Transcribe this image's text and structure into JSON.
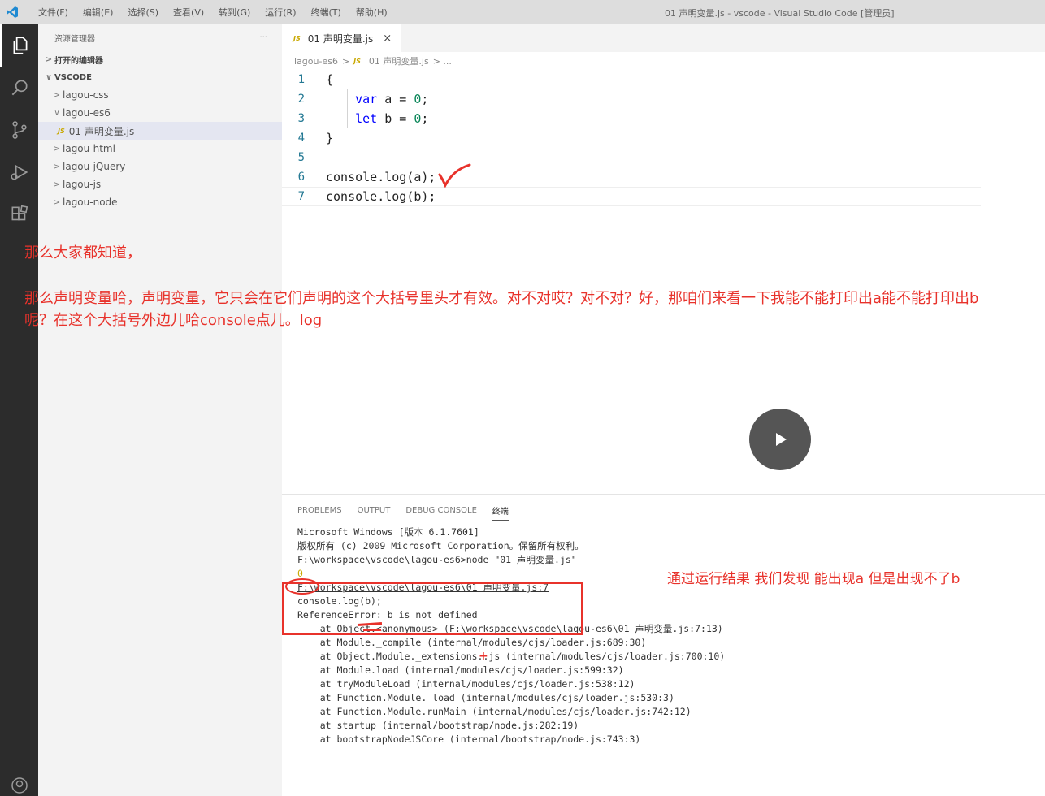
{
  "window": {
    "title": "01 声明变量.js - vscode - Visual Studio Code [管理员]",
    "menu": [
      "文件(F)",
      "编辑(E)",
      "选择(S)",
      "查看(V)",
      "转到(G)",
      "运行(R)",
      "终端(T)",
      "帮助(H)"
    ]
  },
  "activity_bar": {
    "icons": [
      "files-icon",
      "search-icon",
      "source-control-icon",
      "run-debug-icon",
      "extensions-icon",
      "account-icon"
    ]
  },
  "sidebar": {
    "title": "资源管理器",
    "more": "···",
    "open_editors": "打开的编辑器",
    "root": "VSCODE",
    "items": [
      {
        "label": "lagou-css"
      },
      {
        "label": "lagou-es6"
      },
      {
        "label": "01 声明变量.js"
      },
      {
        "label": "lagou-html"
      },
      {
        "label": "lagou-jQuery"
      },
      {
        "label": "lagou-js"
      },
      {
        "label": "lagou-node"
      }
    ],
    "js_badge": "JS"
  },
  "editor": {
    "tab": {
      "badge": "JS",
      "label": "01 声明变量.js",
      "close": "×"
    },
    "breadcrumb": {
      "folder": "lagou-es6",
      "sep": ">",
      "badge": "JS",
      "file": "01 声明变量.js",
      "more": "> ..."
    },
    "lines": [
      {
        "n": "1"
      },
      {
        "n": "2"
      },
      {
        "n": "3"
      },
      {
        "n": "4"
      },
      {
        "n": "5"
      },
      {
        "n": "6"
      },
      {
        "n": "7"
      }
    ],
    "code": {
      "l1": "{",
      "l2_kw": "var",
      "l2_a": " a = ",
      "l2_num": "0",
      "l2_end": ";",
      "l3_kw": "let",
      "l3_a": " b = ",
      "l3_num": "0",
      "l3_end": ";",
      "l4": "}",
      "l5": "",
      "l6": "console.log(a);",
      "l7": "console.log(b);"
    }
  },
  "notes": {
    "n1": "那么大家都知道，",
    "n2": "那么声明变量哈，声明变量，它只会在它们声明的这个大括号里头才有效。对不对哎？对不对？好，那咱们来看一下我能不能打印出a能不能打印出b呢？在这个大括号外边儿哈console点儿。log",
    "n3": "通过运行结果 我们发现 能出现a 但是出现不了b"
  },
  "panel": {
    "tabs": [
      "PROBLEMS",
      "OUTPUT",
      "DEBUG CONSOLE",
      "终端"
    ],
    "terminal": [
      "Microsoft Windows [版本 6.1.7601]",
      "版权所有 (c) 2009 Microsoft Corporation。保留所有权利。",
      "",
      "F:\\workspace\\vscode\\lagou-es6>node \"01 声明变量.js\"",
      "0",
      "F:\\workspace\\vscode\\lagou-es6\\01 声明变量.js:7",
      "console.log(b);",
      "",
      "",
      "ReferenceError: b is not defined",
      "    at Object.<anonymous> (F:\\workspace\\vscode\\lagou-es6\\01 声明变量.js:7:13)",
      "    at Module._compile (internal/modules/cjs/loader.js:689:30)",
      "    at Object.Module._extensions..js (internal/modules/cjs/loader.js:700:10)",
      "    at Module.load (internal/modules/cjs/loader.js:599:32)",
      "    at tryModuleLoad (internal/modules/cjs/loader.js:538:12)",
      "    at Function.Module._load (internal/modules/cjs/loader.js:530:3)",
      "    at Function.Module.runMain (internal/modules/cjs/loader.js:742:12)",
      "    at startup (internal/bootstrap/node.js:282:19)",
      "    at bootstrapNodeJSCore (internal/bootstrap/node.js:743:3)"
    ]
  },
  "annotation": {
    "plus": "+"
  },
  "colors": {
    "accent_red": "#e8322b",
    "activity_bg": "#2c2c2c",
    "keyword": "#0000ff",
    "number": "#098658"
  }
}
